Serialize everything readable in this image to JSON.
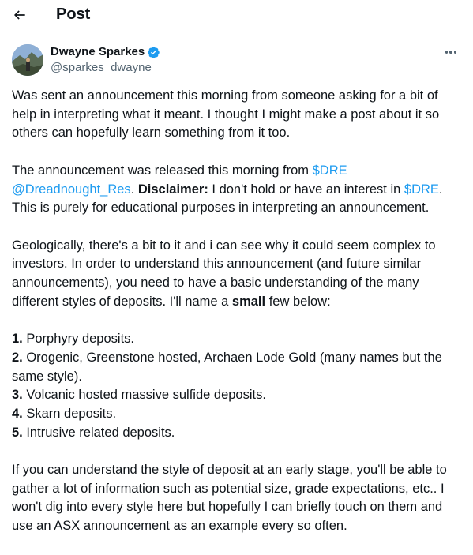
{
  "header": {
    "title": "Post"
  },
  "author": {
    "name": "Dwayne Sparkes",
    "handle": "@sparkes_dwayne",
    "verified": true
  },
  "colors": {
    "accent": "#1d9bf0",
    "text": "#0f1419",
    "muted": "#536471"
  },
  "post": {
    "p1": "Was sent an announcement this morning from someone asking for a bit of help in interpreting what it meant. I thought I might make a post about it so others can hopefully learn something from it too.",
    "p2_intro": "The announcement was released this morning from ",
    "cashtag": "$DRE",
    "mention": "@Dreadnought_Res",
    "disclaimer_label": "Disclaimer:",
    "p2_mid": " I don't hold or have an interest in ",
    "p2_end": ". This is purely for educational purposes in interpreting an announcement.",
    "p3_main": "Geologically, there's a bit to it and i can see why it could seem complex to investors. In order to understand this announcement (and future similar announcements), you need to have a basic understanding of the many different styles of deposits. I'll name a ",
    "p3_bold": "small",
    "p3_end": " few below:",
    "list": [
      {
        "num": "1.",
        "text": " Porphyry deposits."
      },
      {
        "num": "2.",
        "text": " Orogenic, Greenstone hosted, Archaen Lode Gold (many names but the same style)."
      },
      {
        "num": "3.",
        "text": " Volcanic hosted massive sulfide deposits."
      },
      {
        "num": "4.",
        "text": " Skarn deposits."
      },
      {
        "num": "5.",
        "text": " Intrusive related deposits."
      }
    ],
    "p4": "If you can understand the style of deposit at an early stage, you'll be able to gather a lot of information such as potential size, grade expectations, etc.. I won't dig into every style here but hopefully I can briefly touch on them and use an ASX announcement as an example every so often."
  }
}
